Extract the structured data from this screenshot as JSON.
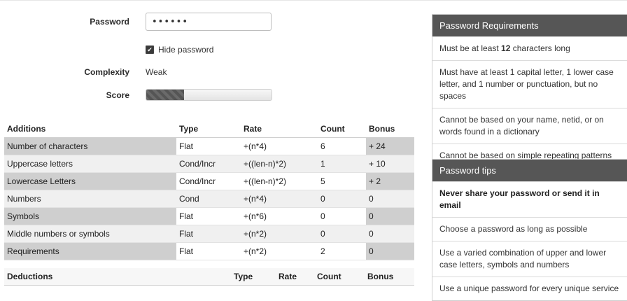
{
  "form": {
    "password_label": "Password",
    "password_value": "••••••",
    "hide_password_label": "Hide password",
    "complexity_label": "Complexity",
    "complexity_value": "Weak",
    "score_label": "Score",
    "score_fraction": 0.3
  },
  "additions": {
    "headers": [
      "Additions",
      "Type",
      "Rate",
      "Count",
      "Bonus"
    ],
    "rows": [
      [
        "Number of characters",
        "Flat",
        "+(n*4)",
        "6",
        "+ 24"
      ],
      [
        "Uppercase letters",
        "Cond/Incr",
        "+((len-n)*2)",
        "1",
        "+ 10"
      ],
      [
        "Lowercase Letters",
        "Cond/Incr",
        "+((len-n)*2)",
        "5",
        "+ 2"
      ],
      [
        "Numbers",
        "Cond",
        "+(n*4)",
        "0",
        "0"
      ],
      [
        "Symbols",
        "Flat",
        "+(n*6)",
        "0",
        "0"
      ],
      [
        "Middle numbers or symbols",
        "Flat",
        "+(n*2)",
        "0",
        "0"
      ],
      [
        "Requirements",
        "Flat",
        "+(n*2)",
        "2",
        "0"
      ]
    ]
  },
  "deductions": {
    "headers": [
      "Deductions",
      "Type",
      "Rate",
      "Count",
      "Bonus"
    ]
  },
  "requirements_panel": {
    "title": "Password Requirements",
    "item1_pre": "Must be at least ",
    "item1_bold": "12",
    "item1_post": " characters long",
    "item2": "Must have at least 1 capital letter, 1 lower case letter, and 1 number or punctuation, but no spaces",
    "item3": "Cannot be based on your name, netid, or on words found in a dictionary",
    "item4": "Cannot be based on simple repeating patterns"
  },
  "tips_panel": {
    "title": "Password tips",
    "tip1": "Never share your password or send it in email",
    "tip2": "Choose a password as long as possible",
    "tip3": "Use a varied combination of upper and lower case letters, symbols and numbers",
    "tip4": "Use a unique password for every unique service"
  }
}
